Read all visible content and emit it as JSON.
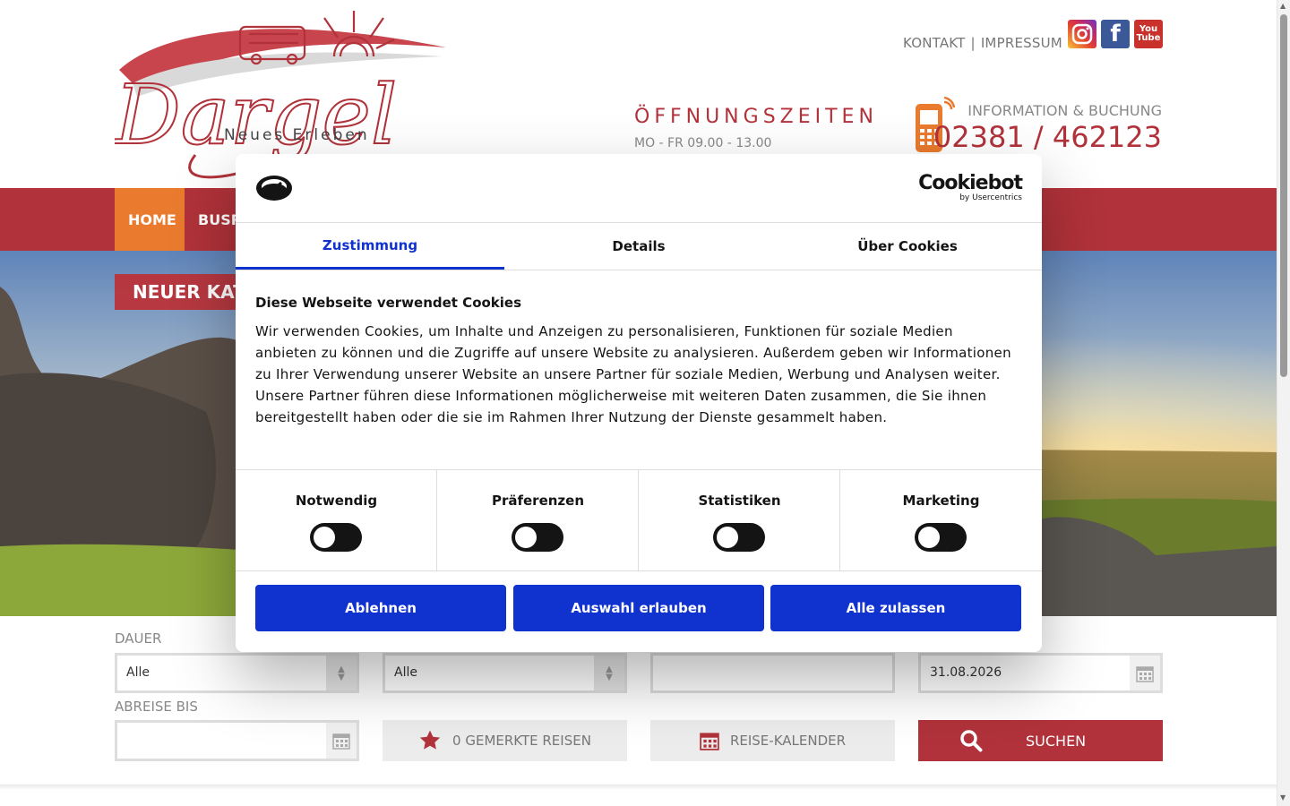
{
  "header": {
    "logo": {
      "brand": "Dargel",
      "tagline": "Neues Erleben"
    },
    "links": {
      "contact": "KONTAKT",
      "separator": "|",
      "imprint": "IMPRESSUM"
    },
    "social": {
      "instagram_icon": "instagram-icon",
      "facebook_glyph": "f",
      "youtube_line1": "You",
      "youtube_line2": "Tube"
    },
    "hours_title": "ÖFFNUNGSZEITEN",
    "hours_text": "MO - FR 09.00 - 13.00",
    "info_label": "INFORMATION & BUCHUNG",
    "phone": "02381 / 462123"
  },
  "nav": {
    "home": "HOME",
    "bus": "BUSR"
  },
  "hero": {
    "banner": "NEUER KAT"
  },
  "search": {
    "duration_label": "DAUER",
    "duration_value": "Alle",
    "second_value": "Alle",
    "date_value": "31.08.2026",
    "return_label": "ABREISE BIS",
    "saved_trips": "0 GEMERKTE REISEN",
    "calendar": "REISE-KALENDER",
    "search": "SUCHEN"
  },
  "cookie": {
    "brand": "Cookiebot",
    "brand_sub": "by Usercentrics",
    "tabs": [
      "Zustimmung",
      "Details",
      "Über Cookies"
    ],
    "title": "Diese Webseite verwendet Cookies",
    "body": "Wir verwenden Cookies, um Inhalte und Anzeigen zu personalisieren, Funktionen für soziale Medien anbieten zu können und die Zugriffe auf unsere Website zu analysieren. Außerdem geben wir Informationen zu Ihrer Verwendung unserer Website an unsere Partner für soziale Medien, Werbung und Analysen weiter. Unsere Partner führen diese Informationen möglicherweise mit weiteren Daten zusammen, die Sie ihnen bereitgestellt haben oder die sie im Rahmen Ihrer Nutzung der Dienste gesammelt haben.",
    "toggles": [
      "Notwendig",
      "Präferenzen",
      "Statistiken",
      "Marketing"
    ],
    "buttons": {
      "deny": "Ablehnen",
      "allow_selection": "Auswahl erlauben",
      "allow_all": "Alle zulassen"
    }
  },
  "colors": {
    "brand_red": "#b1323a",
    "nav_active": "#ea7b2e",
    "cookie_blue": "#1032cf"
  }
}
